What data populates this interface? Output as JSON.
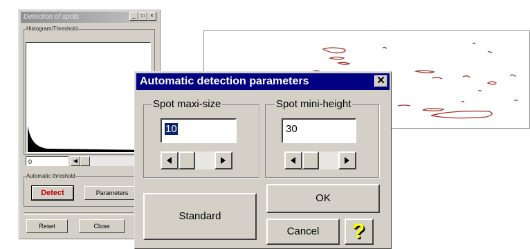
{
  "detection_window": {
    "title": "Detection of spots",
    "histogram_group_label": "Histogram/Threshold",
    "threshold_value": "0",
    "auto_threshold_label": "Automatic threshold",
    "detect_button": "Detect",
    "parameters_button": "Parameters",
    "reset_button": "Reset",
    "close_button": "Close"
  },
  "dialog": {
    "title": "Automatic detection parameters",
    "close_glyph": "✕",
    "spot_maxi_size": {
      "label": "Spot maxi-size",
      "value": "10"
    },
    "spot_mini_height": {
      "label": "Spot mini-height",
      "value": "30"
    },
    "buttons": {
      "standard": "Standard",
      "ok": "OK",
      "cancel": "Cancel",
      "help": "?"
    }
  },
  "colors": {
    "dialog_title_bg": "#000080",
    "help_question_mark": "#ffff00",
    "detect_text": "#c00000",
    "spot_outline": "#a0302a"
  }
}
